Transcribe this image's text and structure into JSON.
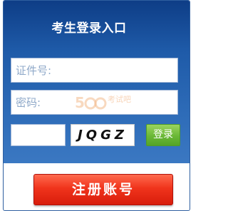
{
  "login": {
    "title": "考生登录入口",
    "id_placeholder": "证件号:",
    "password_placeholder": "密码:",
    "captcha_value": "",
    "captcha_text": "JQGZ",
    "login_label": "登录"
  },
  "register": {
    "label": "注册账号"
  },
  "watermark": {
    "text": "考试吧"
  },
  "colors": {
    "panel_blue": "#1e5aa8",
    "login_green": "#6ab836",
    "register_red": "#f0341c"
  }
}
